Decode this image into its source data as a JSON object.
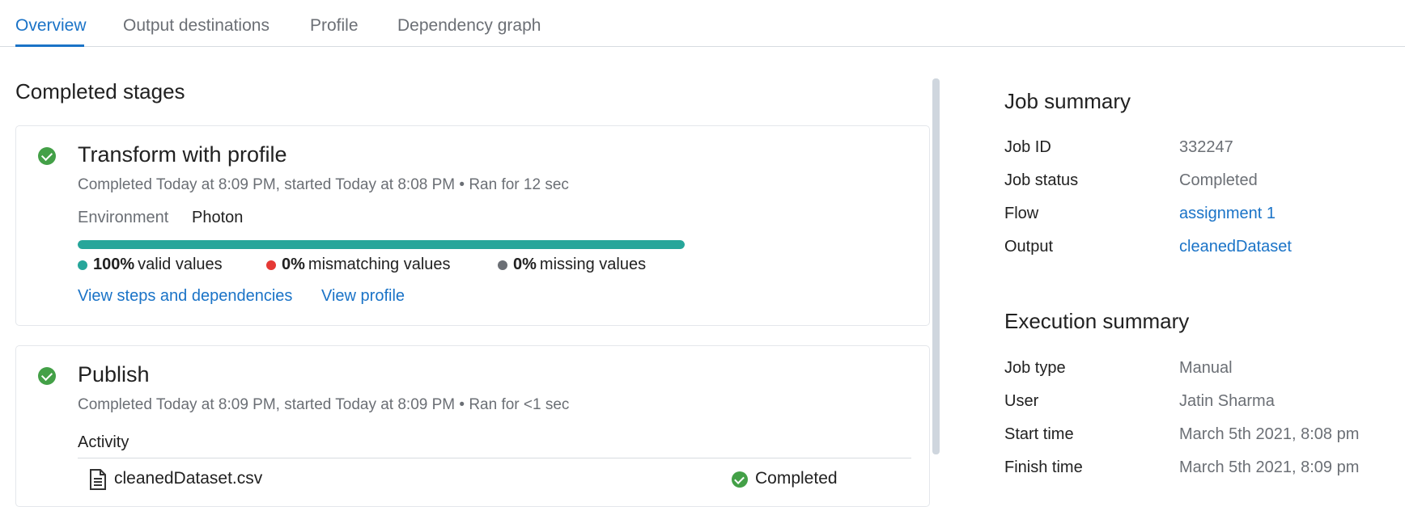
{
  "tabs": [
    {
      "label": "Overview",
      "active": true
    },
    {
      "label": "Output destinations",
      "active": false
    },
    {
      "label": "Profile",
      "active": false
    },
    {
      "label": "Dependency graph",
      "active": false
    }
  ],
  "completed_stages": {
    "title": "Completed stages",
    "transform": {
      "status_icon": "check-circle-icon",
      "title": "Transform with profile",
      "meta": "Completed Today at 8:09 PM, started Today at 8:08 PM • Ran for 12 sec",
      "environment_label": "Environment",
      "environment_value": "Photon",
      "valid_fraction": 1.0,
      "stats": [
        {
          "percent": "100%",
          "label": "valid values",
          "color": "#26a69a"
        },
        {
          "percent": "0%",
          "label": "mismatching values",
          "color": "#e53935"
        },
        {
          "percent": "0%",
          "label": "missing values",
          "color": "#6b6f75"
        }
      ],
      "links": [
        "View steps and dependencies",
        "View profile"
      ]
    },
    "publish": {
      "status_icon": "check-circle-icon",
      "title": "Publish",
      "meta": "Completed Today at 8:09 PM, started Today at 8:09 PM • Ran for <1 sec",
      "activity_label": "Activity",
      "files": [
        {
          "icon": "file-icon",
          "name": "cleanedDataset.csv",
          "status": "Completed"
        }
      ]
    }
  },
  "job_summary": {
    "title": "Job summary",
    "rows": [
      {
        "label": "Job ID",
        "value": "332247",
        "link": false
      },
      {
        "label": "Job status",
        "value": "Completed",
        "link": false
      },
      {
        "label": "Flow",
        "value": "assignment 1",
        "link": true
      },
      {
        "label": "Output",
        "value": "cleanedDataset",
        "link": true
      }
    ]
  },
  "execution_summary": {
    "title": "Execution summary",
    "rows": [
      {
        "label": "Job type",
        "value": "Manual"
      },
      {
        "label": "User",
        "value": "Jatin Sharma"
      },
      {
        "label": "Start time",
        "value": "March 5th 2021, 8:08 pm"
      },
      {
        "label": "Finish time",
        "value": "March 5th 2021, 8:09 pm"
      }
    ]
  },
  "colors": {
    "accent": "#1a73c7",
    "success": "#43a047",
    "valid": "#26a69a",
    "mismatch": "#e53935",
    "missing": "#6b6f75"
  }
}
